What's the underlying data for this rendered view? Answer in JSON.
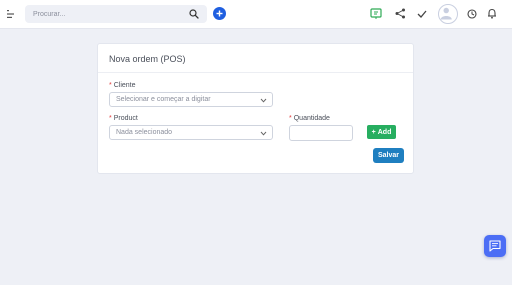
{
  "topbar": {
    "search": {
      "placeholder": "Procurar..."
    },
    "icons": [
      "menu-toggle-icon",
      "search-icon",
      "add-icon",
      "presentation-icon",
      "share-icon",
      "check-icon",
      "user-avatar",
      "clock-icon",
      "bell-icon"
    ]
  },
  "form": {
    "title": "Nova ordem (POS)",
    "cliente": {
      "required_mark": "*",
      "label": "Cliente",
      "placeholder": "Selecionar e começar a digitar"
    },
    "product": {
      "required_mark": "*",
      "label": "Product",
      "placeholder": "Nada selecionado"
    },
    "quantidade": {
      "required_mark": "*",
      "label": "Quantidade",
      "value": ""
    },
    "add_button": {
      "icon": "+",
      "label": "Add"
    },
    "save_button": {
      "label": "Salvar"
    }
  },
  "colors": {
    "background": "#eef0f6",
    "add_green": "#27ae60",
    "save_blue": "#1f7fc0",
    "primary_blue": "#1f5fe0",
    "chat_blue": "#4c6ef5",
    "required_red": "#e03a3a",
    "presentation_green": "#2eaa55"
  }
}
